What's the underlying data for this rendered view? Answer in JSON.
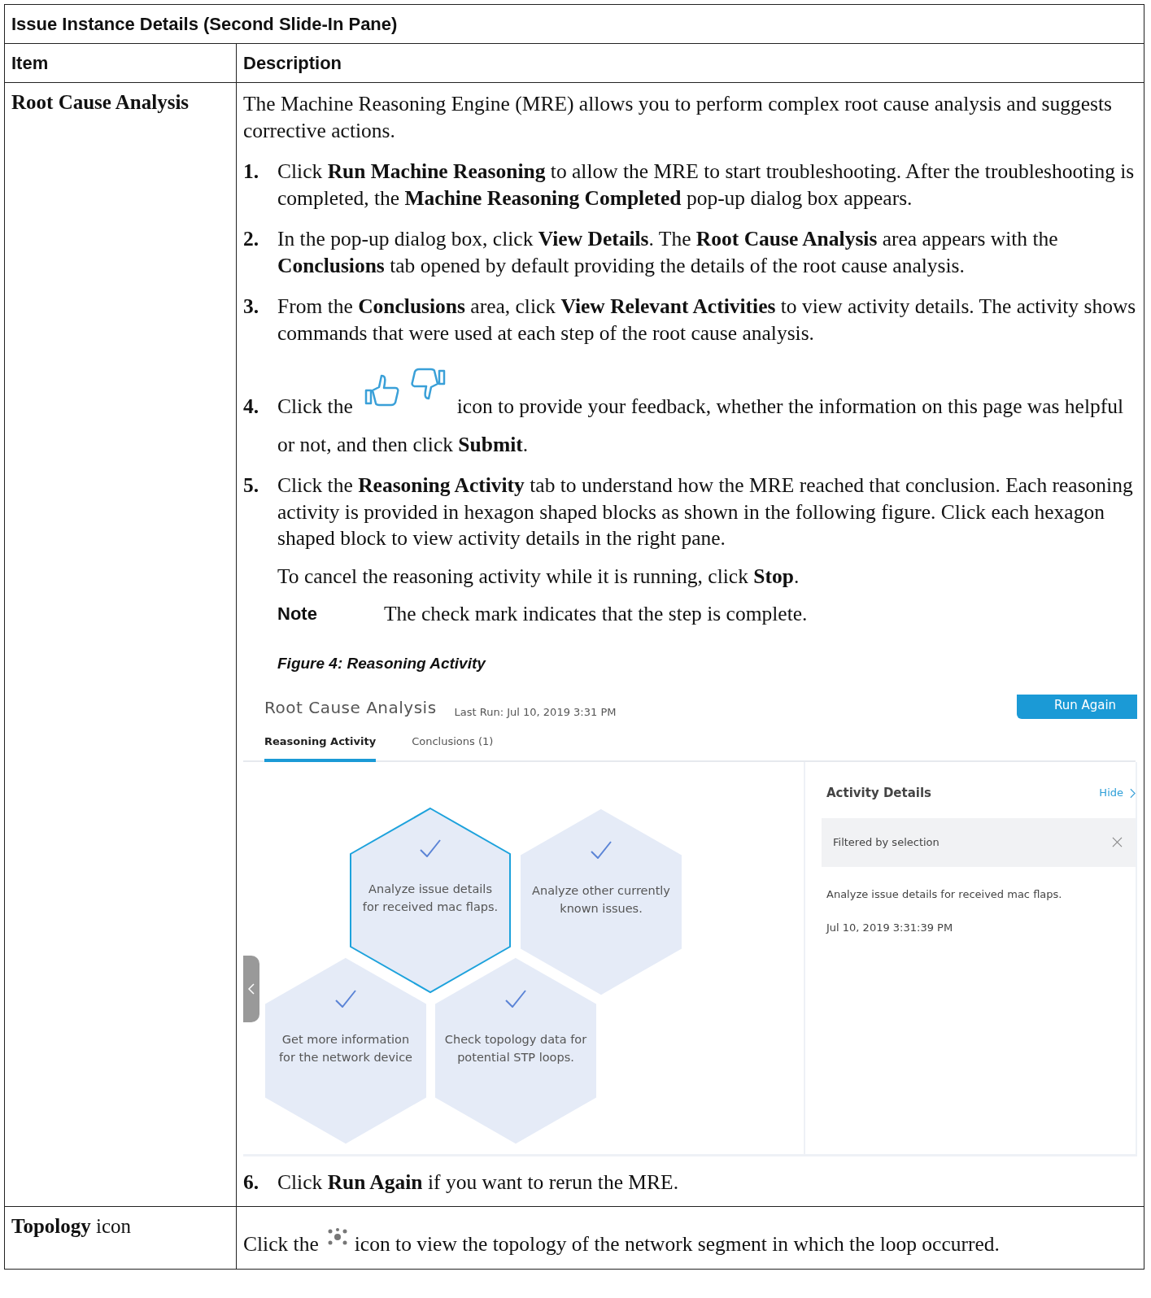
{
  "table": {
    "title": "Issue Instance Details (Second Slide-In Pane)",
    "columns": [
      "Item",
      "Description"
    ],
    "rows": [
      {
        "kind": "steps",
        "item": "Root Cause Analysis",
        "intro": "The Machine Reasoning Engine (MRE) allows you to perform complex root cause analysis and suggests corrective actions.",
        "steps": [
          {
            "kind": "plain",
            "number": "1.",
            "text": "Click **Run Machine Reasoning** to allow the MRE to start troubleshooting. After the troubleshooting is completed, the **Machine Reasoning Completed** pop-up dialog box appears."
          },
          {
            "kind": "plain",
            "number": "2.",
            "text": "In the pop-up dialog box, click **View Details**. The **Root Cause Analysis** area appears with the **Conclusions** tab opened by default providing the details of the root cause analysis."
          },
          {
            "kind": "plain",
            "number": "3.",
            "text": "From the **Conclusions** area, click **View Relevant Activities**  to view activity details. The activity shows commands that were used at each step of the root cause analysis."
          },
          {
            "kind": "feedback",
            "number": "4.",
            "text": "Click the",
            "text_after": "icon to provide your feedback, whether the information on this page was helpful",
            "text_cont": "or not, and then click **Submit**."
          },
          {
            "kind": "figure",
            "number": "5.",
            "text": "Click the **Reasoning Activity** tab to understand how the MRE reached that conclusion. Each reasoning activity is provided in hexagon shaped blocks as shown in the following figure. Click each hexagon shaped block to view activity details in the right pane.",
            "extra": "To cancel the reasoning activity while it is running, click **Stop**.",
            "note": {
              "label": "Note",
              "text": "The check mark indicates that the step is complete."
            },
            "figure": {
              "caption": "Figure 4: Reasoning Activity",
              "title": "Root Cause Analysis",
              "last_run": "Last Run: Jul 10, 2019 3:31 PM",
              "button": "Run Again",
              "tabs": [
                {
                  "label": "Reasoning Activity",
                  "selected": true
                },
                {
                  "label": "Conclusions (1)",
                  "selected": false
                }
              ],
              "hexagons": [
                {
                  "text": "Analyze issue details for received mac flaps.",
                  "selected": true,
                  "checked": true
                },
                {
                  "text": "Analyze other currently known issues.",
                  "selected": false,
                  "checked": true
                },
                {
                  "text": "Get more information for the network device",
                  "selected": false,
                  "checked": true
                },
                {
                  "text": "Check topology data for potential STP loops.",
                  "selected": false,
                  "checked": true
                }
              ],
              "details": {
                "title": "Activity Details",
                "hide": "Hide",
                "filter": "Filtered by selection",
                "entry": "Analyze issue details for received mac flaps.",
                "time": "Jul 10, 2019 3:31:39 PM"
              }
            }
          },
          {
            "kind": "plain",
            "number": "6.",
            "text": "Click **Run Again** if you want to rerun the MRE."
          }
        ]
      },
      {
        "kind": "icon",
        "item": "**Topology**  icon",
        "text": "Click the",
        "text_after": "icon to view the topology of the network segment in which the loop occurred."
      }
    ]
  }
}
